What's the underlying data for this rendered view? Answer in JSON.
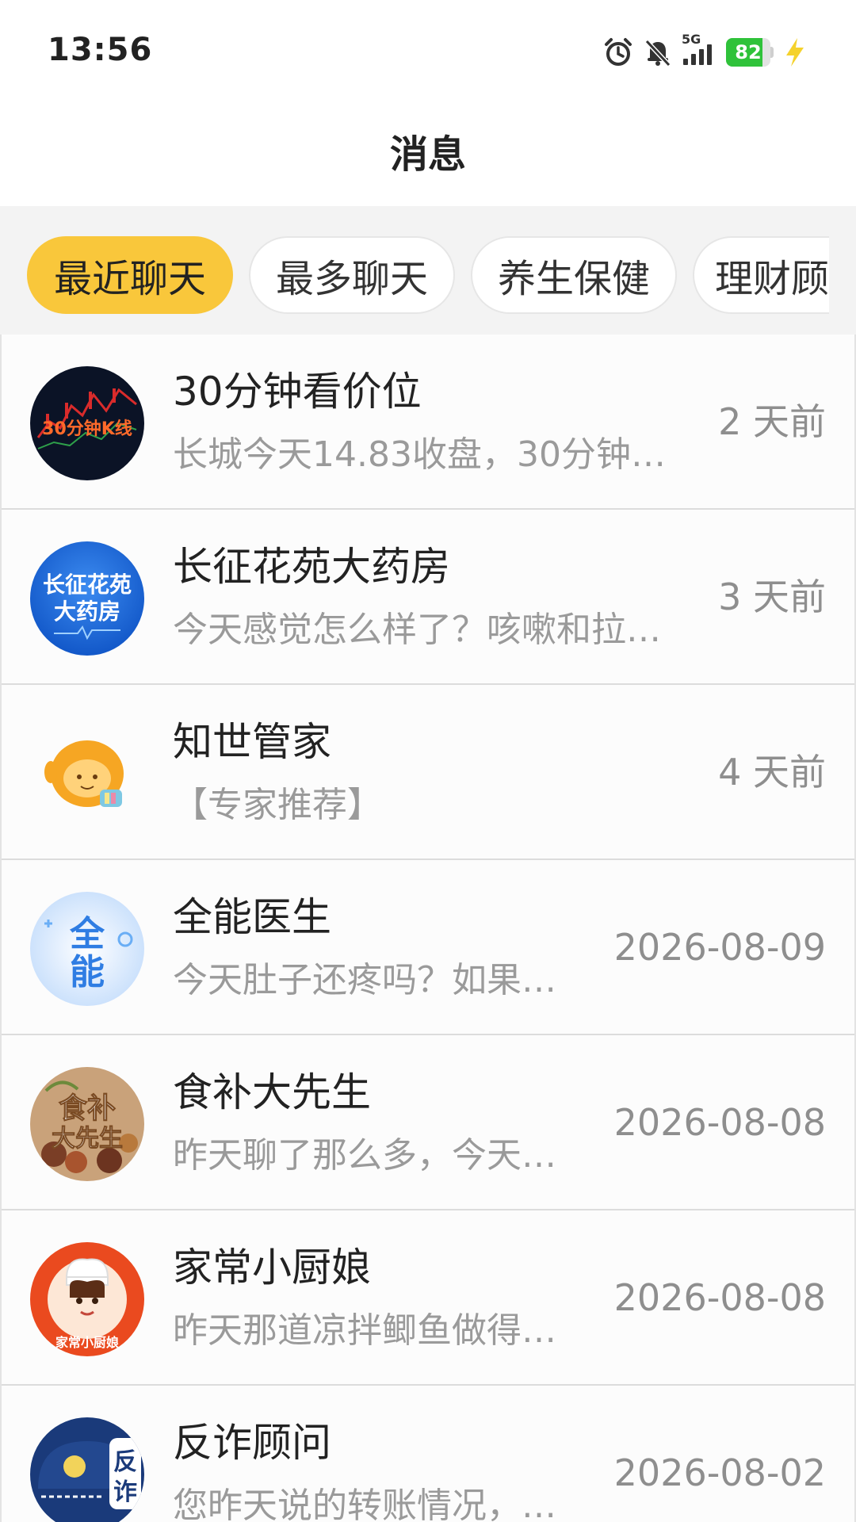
{
  "status_bar": {
    "time": "13:56",
    "network": "5G",
    "battery_level": 82,
    "battery_text": "82",
    "icons": [
      "alarm-icon",
      "bell-off-icon",
      "signal-icon",
      "battery-icon",
      "charging-icon"
    ]
  },
  "header": {
    "title": "消息"
  },
  "tabs": [
    {
      "label": "最近聊天",
      "active": true
    },
    {
      "label": "最多聊天",
      "active": false
    },
    {
      "label": "养生保健",
      "active": false
    },
    {
      "label": "理财顾",
      "active": false
    }
  ],
  "colors": {
    "accent": "#f9c73b",
    "battery_green": "#2fc23a",
    "charging_yellow": "#f5d22c"
  },
  "chats": [
    {
      "name": "30分钟看价位",
      "preview": "长城今天14.83收盘，30分钟…",
      "time": "2 天前",
      "avatar_text": "30分钟K线"
    },
    {
      "name": "长征花苑大药房",
      "preview": "今天感觉怎么样了？咳嗽和拉…",
      "time": "3 天前",
      "avatar_text": "长征花苑 大药房"
    },
    {
      "name": "知世管家",
      "preview": "【专家推荐】",
      "time": "4 天前",
      "avatar_text": ""
    },
    {
      "name": "全能医生",
      "preview": "今天肚子还疼吗？如果…",
      "time": "2026-08-09",
      "avatar_text": "全能"
    },
    {
      "name": "食补大先生",
      "preview": "昨天聊了那么多，今天…",
      "time": "2026-08-08",
      "avatar_text": "食补 大先生"
    },
    {
      "name": "家常小厨娘",
      "preview": "昨天那道凉拌鲫鱼做得…",
      "time": "2026-08-08",
      "avatar_text": "家常小厨娘"
    },
    {
      "name": "反诈顾问",
      "preview": "您昨天说的转账情况，…",
      "time": "2026-08-02",
      "avatar_text": "反诈"
    }
  ]
}
